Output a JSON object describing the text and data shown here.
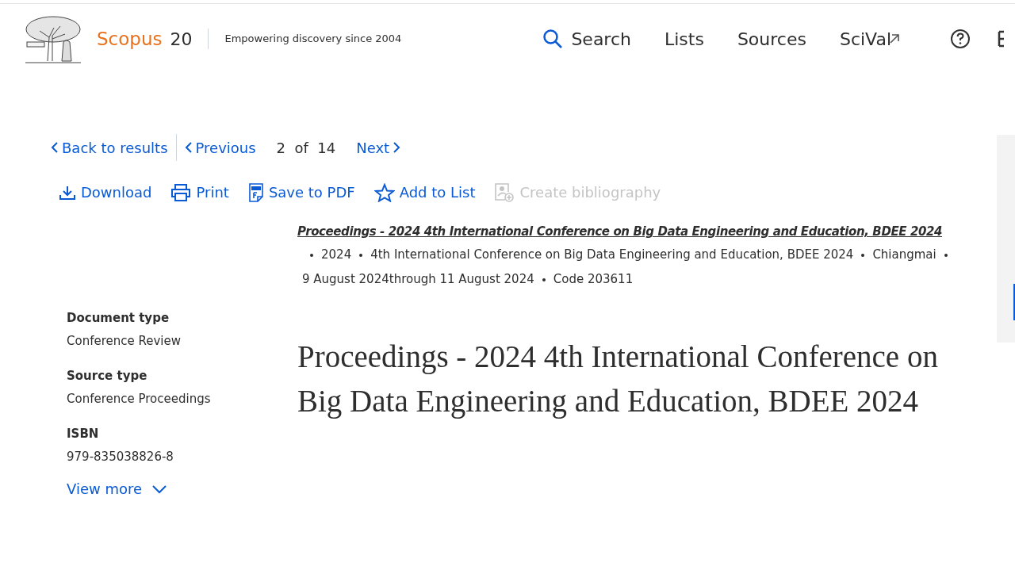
{
  "header": {
    "brand": "Scopus",
    "version": "20",
    "tagline": "Empowering discovery since 2004",
    "nav": [
      {
        "label": "Search",
        "kind": "search"
      },
      {
        "label": "Lists",
        "kind": "plain"
      },
      {
        "label": "Sources",
        "kind": "plain"
      },
      {
        "label": "SciVal",
        "kind": "external"
      }
    ]
  },
  "pager": {
    "back": "Back to results",
    "previous": "Previous",
    "current": "2",
    "of": "of",
    "total": "14",
    "next": "Next"
  },
  "actions": [
    {
      "label": "Download",
      "kind": "download",
      "disabled": false
    },
    {
      "label": "Print",
      "kind": "print",
      "disabled": false
    },
    {
      "label": "Save to PDF",
      "kind": "pdf",
      "disabled": false
    },
    {
      "label": "Add to List",
      "kind": "star",
      "disabled": false
    },
    {
      "label": "Create bibliography",
      "kind": "bibliography",
      "disabled": true
    }
  ],
  "source": {
    "title": "Proceedings - 2024 4th International Conference on Big Data Engineering and Education, BDEE 2024",
    "details": [
      "2024",
      "4th International Conference on Big Data Engineering and Education, BDEE 2024",
      "Chiangmai",
      "9 August 2024through 11 August 2024",
      "Code 203611"
    ]
  },
  "metadata": [
    {
      "label": "Document type",
      "value": "Conference Review"
    },
    {
      "label": "Source type",
      "value": "Conference Proceedings"
    },
    {
      "label": "ISBN",
      "value": "979-835038826-8"
    }
  ],
  "view_more": "View more",
  "document_title": "Proceedings - 2024 4th International Conference on Big Data Engineering and Education, BDEE 2024"
}
